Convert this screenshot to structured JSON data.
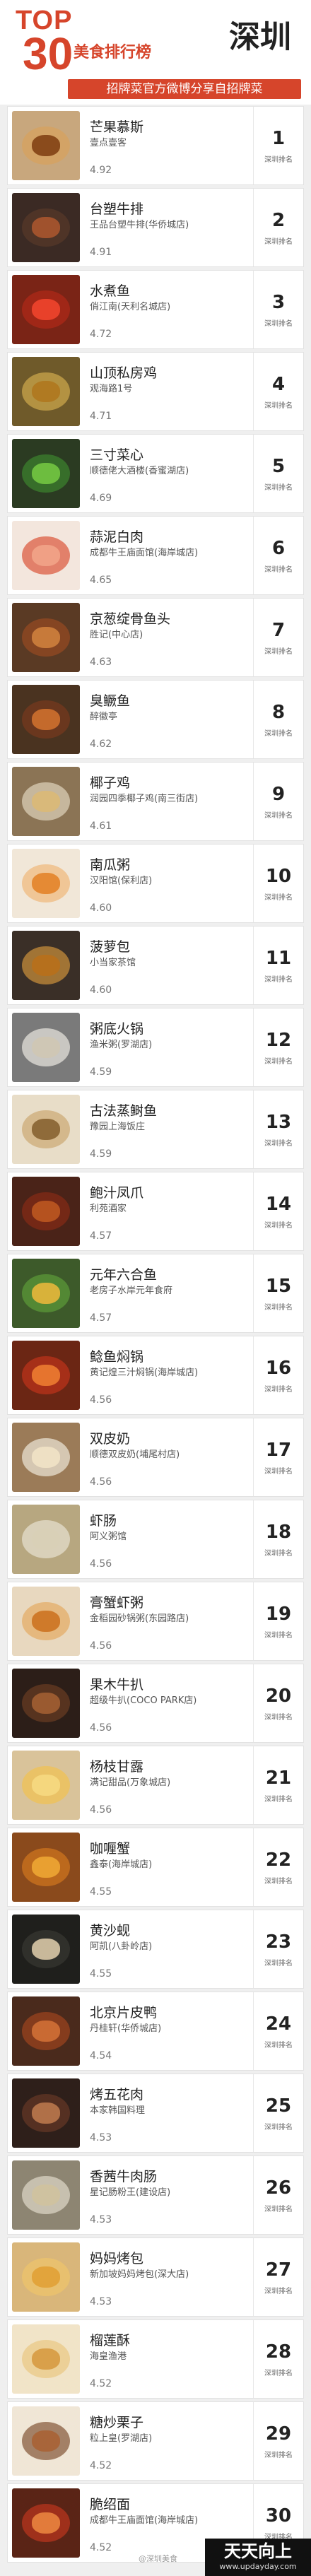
{
  "header": {
    "top_word": "TOP",
    "number": "30",
    "rank_title": "美食排行榜",
    "city": "深圳",
    "subtitle": "招牌菜官方微博分享自招牌菜"
  },
  "rank_label": "深圳排名",
  "items": [
    {
      "name": "芒果慕斯",
      "place": "壹点壹客",
      "score": "4.92",
      "rank": "1",
      "plate": "#d9a15a",
      "food": "#8a4b1c",
      "bg": "#c8a77d"
    },
    {
      "name": "台塑牛排",
      "place": "王品台塑牛排(华侨城店)",
      "score": "4.91",
      "rank": "2",
      "plate": "#5b3a2a",
      "food": "#a0522d",
      "bg": "#3b2a24"
    },
    {
      "name": "水煮鱼",
      "place": "俏江南(天利名城店)",
      "score": "4.72",
      "rank": "3",
      "plate": "#b52a19",
      "food": "#e8412a",
      "bg": "#7a2416"
    },
    {
      "name": "山顶私房鸡",
      "place": "观海路1号",
      "score": "4.71",
      "rank": "4",
      "plate": "#d7b150",
      "food": "#b07a22",
      "bg": "#6f5a2a"
    },
    {
      "name": "三寸菜心",
      "place": "顺德佬大酒楼(香蜜湖店)",
      "score": "4.69",
      "rank": "5",
      "plate": "#3d8a2f",
      "food": "#6dbd3f",
      "bg": "#2b3b22"
    },
    {
      "name": "蒜泥白肉",
      "place": "成都牛王庙面馆(海岸城店)",
      "score": "4.65",
      "rank": "6",
      "plate": "#d84a2c",
      "food": "#f0a085",
      "bg": "#f3e6dd"
    },
    {
      "name": "京葱绽骨鱼头",
      "place": "胜记(中心店)",
      "score": "4.63",
      "rank": "7",
      "plate": "#9c4b22",
      "food": "#c77a3a",
      "bg": "#5a3a24"
    },
    {
      "name": "臭鳜鱼",
      "place": "醉徽亭",
      "score": "4.62",
      "rank": "8",
      "plate": "#7b3b1d",
      "food": "#c46a2c",
      "bg": "#4a3320"
    },
    {
      "name": "椰子鸡",
      "place": "润园四季椰子鸡(南三街店)",
      "score": "4.61",
      "rank": "9",
      "plate": "#e6dcc4",
      "food": "#d9b97a",
      "bg": "#8b7455"
    },
    {
      "name": "南瓜粥",
      "place": "汉阳馆(保利店)",
      "score": "4.60",
      "rank": "10",
      "plate": "#efb473",
      "food": "#e58a34",
      "bg": "#f1e7d8"
    },
    {
      "name": "菠萝包",
      "place": "小当家茶馆",
      "score": "4.60",
      "rank": "11",
      "plate": "#d99a3e",
      "food": "#b6701d",
      "bg": "#3a2f27"
    },
    {
      "name": "粥底火锅",
      "place": "渔米粥(罗湖店)",
      "score": "4.59",
      "rank": "12",
      "plate": "#f4f1ea",
      "food": "#cfc7b5",
      "bg": "#7a7a7a"
    },
    {
      "name": "古法蒸鲥鱼",
      "place": "豫园上海饭庄",
      "score": "4.59",
      "rank": "13",
      "plate": "#caa46c",
      "food": "#8f6b3a",
      "bg": "#e8ddc8"
    },
    {
      "name": "鲍汁凤爪",
      "place": "利苑酒家",
      "score": "4.57",
      "rank": "14",
      "plate": "#8a2b16",
      "food": "#b5521f",
      "bg": "#4a2318"
    },
    {
      "name": "元年六合鱼",
      "place": "老房子水岸元年食府",
      "score": "4.57",
      "rank": "15",
      "plate": "#5fa13a",
      "food": "#d8b23a",
      "bg": "#3d5a2a"
    },
    {
      "name": "鲶鱼焖锅",
      "place": "黄记煌三汁焖锅(海岸城店)",
      "score": "4.56",
      "rank": "16",
      "plate": "#c6341a",
      "food": "#e6742e",
      "bg": "#6b2614"
    },
    {
      "name": "双皮奶",
      "place": "顺德双皮奶(埔尾村店)",
      "score": "4.56",
      "rank": "17",
      "plate": "#f5efe3",
      "food": "#eee0c4",
      "bg": "#9b7b58"
    },
    {
      "name": "虾肠",
      "place": "阿义粥馆",
      "score": "4.56",
      "rank": "18",
      "plate": "#ebe6d7",
      "food": "#d9d0b7",
      "bg": "#b7a780"
    },
    {
      "name": "膏蟹虾粥",
      "place": "金稻园砂锅粥(东园路店)",
      "score": "4.56",
      "rank": "19",
      "plate": "#e3a85a",
      "food": "#cf7a2a",
      "bg": "#e8d8bf"
    },
    {
      "name": "果木牛扒",
      "place": "超级牛扒(COCO PARK店)",
      "score": "4.56",
      "rank": "20",
      "plate": "#6e3f23",
      "food": "#9a5a30",
      "bg": "#2c1e18"
    },
    {
      "name": "杨枝甘露",
      "place": "满记甜品(万象城店)",
      "score": "4.56",
      "rank": "21",
      "plate": "#f2c24a",
      "food": "#f5d77e",
      "bg": "#d9c39a"
    },
    {
      "name": "咖喱蟹",
      "place": "鑫泰(海岸城店)",
      "score": "4.55",
      "rank": "22",
      "plate": "#d77a1f",
      "food": "#e9a031",
      "bg": "#8a4a1c"
    },
    {
      "name": "黄沙蚬",
      "place": "阿凯(八卦岭店)",
      "score": "4.55",
      "rank": "23",
      "plate": "#3a3a34",
      "food": "#c8b89a",
      "bg": "#1f1f1c"
    },
    {
      "name": "北京片皮鸭",
      "place": "丹桂轩(华侨城店)",
      "score": "4.54",
      "rank": "24",
      "plate": "#a4471f",
      "food": "#c96a33",
      "bg": "#4a2a1c"
    },
    {
      "name": "烤五花肉",
      "place": "本家韩国料理",
      "score": "4.53",
      "rank": "25",
      "plate": "#6a3a26",
      "food": "#b07048",
      "bg": "#2e1f1a"
    },
    {
      "name": "香茜牛肉肠",
      "place": "星记肠粉王(建设店)",
      "score": "4.53",
      "rank": "26",
      "plate": "#e7e1cf",
      "food": "#cfc2a0",
      "bg": "#8d8572"
    },
    {
      "name": "妈妈烤包",
      "place": "新加坡妈妈烤包(深大店)",
      "score": "4.53",
      "rank": "27",
      "plate": "#f0c66a",
      "food": "#e2a43c",
      "bg": "#d9b67a"
    },
    {
      "name": "榴莲酥",
      "place": "海皇渔港",
      "score": "4.52",
      "rank": "28",
      "plate": "#e9c47c",
      "food": "#d9a04a",
      "bg": "#f1e4c8"
    },
    {
      "name": "糖炒栗子",
      "place": "粒上皇(罗湖店)",
      "score": "4.52",
      "rank": "29",
      "plate": "#7a4a2a",
      "food": "#a8653a",
      "bg": "#f0e6d6"
    },
    {
      "name": "脆绍面",
      "place": "成都牛王庙面馆(海岸城店)",
      "score": "4.52",
      "rank": "30",
      "plate": "#c4381e",
      "food": "#e27b3b",
      "bg": "#5a2416"
    }
  ],
  "watermark": "@深圳美食",
  "brand": {
    "main": "天天向上",
    "url": "www.updayday.com"
  }
}
